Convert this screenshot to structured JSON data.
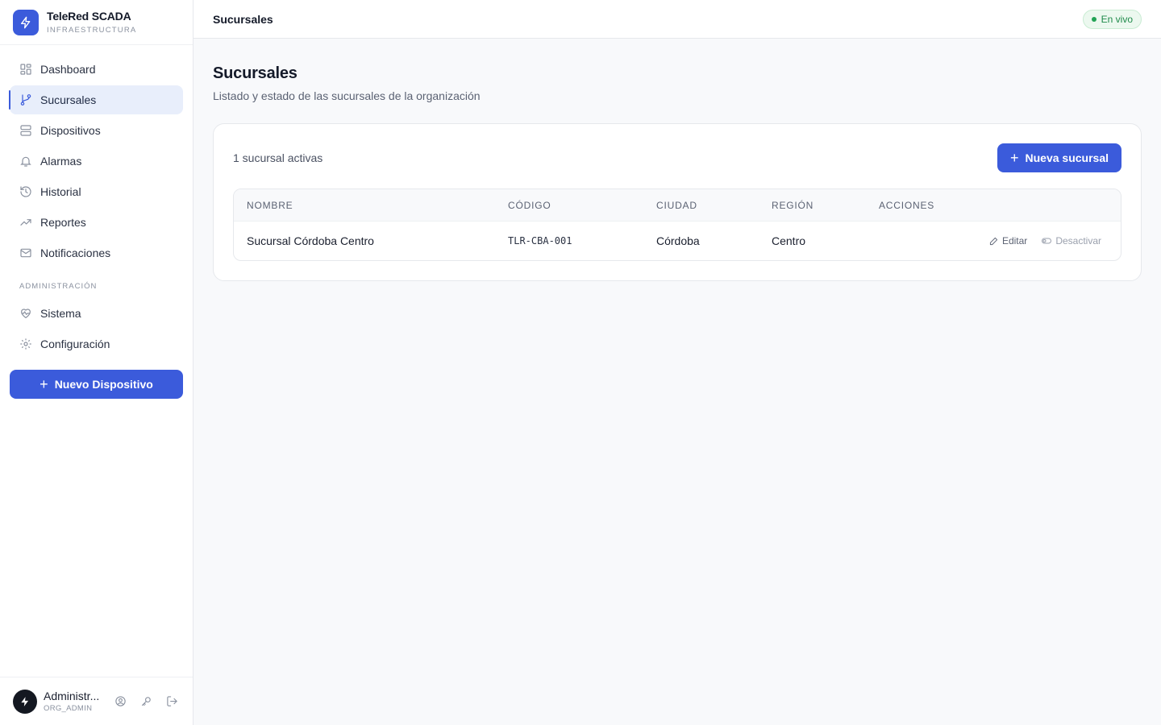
{
  "brand": {
    "title": "TeleRed SCADA",
    "subtitle": "INFRAESTRUCTURA"
  },
  "sidebar": {
    "items": [
      {
        "label": "Dashboard",
        "icon": "grid-icon"
      },
      {
        "label": "Sucursales",
        "icon": "branch-icon",
        "active": true
      },
      {
        "label": "Dispositivos",
        "icon": "server-icon"
      },
      {
        "label": "Alarmas",
        "icon": "bell-icon"
      },
      {
        "label": "Historial",
        "icon": "history-icon"
      },
      {
        "label": "Reportes",
        "icon": "trending-icon"
      },
      {
        "label": "Notificaciones",
        "icon": "mail-icon"
      }
    ],
    "section_label": "ADMINISTRACIÓN",
    "admin_items": [
      {
        "label": "Sistema",
        "icon": "heart-pulse-icon"
      },
      {
        "label": "Configuración",
        "icon": "gear-icon"
      }
    ],
    "new_device_label": "Nuevo Dispositivo"
  },
  "user": {
    "name": "Administr...",
    "role": "ORG_ADMIN"
  },
  "topbar": {
    "title": "Sucursales",
    "status": "En vivo"
  },
  "page": {
    "title": "Sucursales",
    "subtitle": "Listado y estado de las sucursales de la organización"
  },
  "card": {
    "count_text": "1 sucursal activas",
    "add_label": "Nueva sucursal",
    "columns": [
      "NOMBRE",
      "CÓDIGO",
      "CIUDAD",
      "REGIÓN",
      "ACCIONES"
    ],
    "rows": [
      {
        "name": "Sucursal Córdoba Centro",
        "code": "TLR-CBA-001",
        "city": "Córdoba",
        "region": "Centro"
      }
    ],
    "edit_label": "Editar",
    "deactivate_label": "Desactivar"
  },
  "colors": {
    "accent": "#3b5bdb",
    "live": "#22a355"
  }
}
